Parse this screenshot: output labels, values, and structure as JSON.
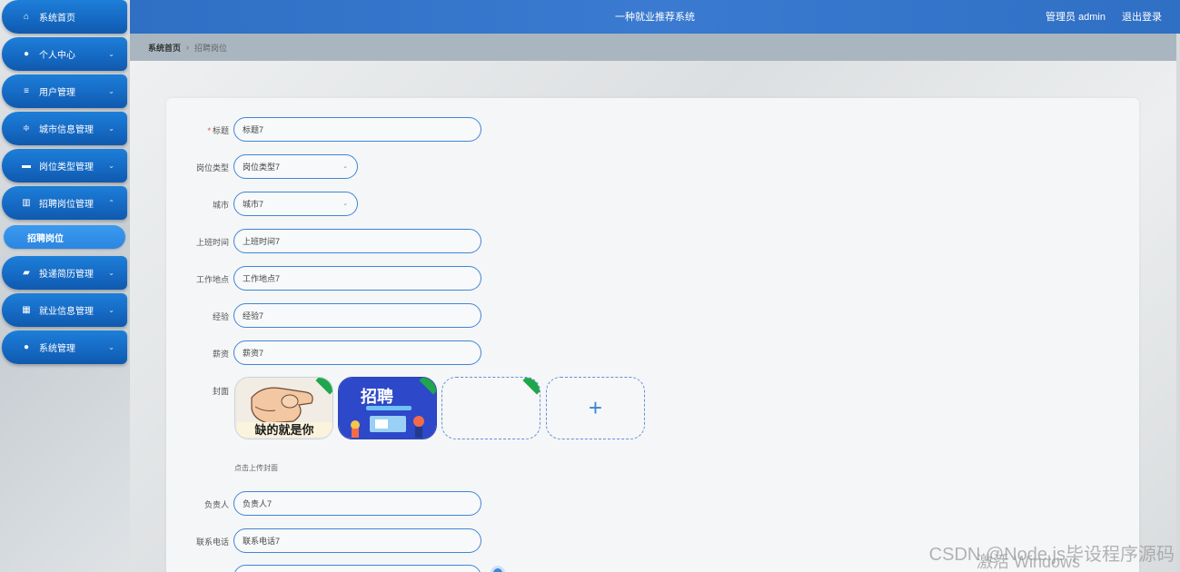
{
  "header": {
    "title": "一种就业推荐系统",
    "user": "管理员 admin",
    "logout": "退出登录"
  },
  "breadcrumb": {
    "home": "系统首页",
    "separator": "›",
    "current": "招聘岗位"
  },
  "sidebar": {
    "items": [
      {
        "label": "系统首页",
        "icon": "home-icon",
        "glyph": "⌂",
        "chevron": ""
      },
      {
        "label": "个人中心",
        "icon": "person-icon",
        "glyph": "●",
        "chevron": "⌄"
      },
      {
        "label": "用户管理",
        "icon": "list-icon",
        "glyph": "≡",
        "chevron": "⌄"
      },
      {
        "label": "城市信息管理",
        "icon": "sliders-icon",
        "glyph": "≑",
        "chevron": "⌄"
      },
      {
        "label": "岗位类型管理",
        "icon": "briefcase-icon",
        "glyph": "▬",
        "chevron": "⌄"
      },
      {
        "label": "招聘岗位管理",
        "icon": "chart-icon",
        "glyph": "▥",
        "chevron": "⌃"
      },
      {
        "label": "投递简历管理",
        "icon": "hand-icon",
        "glyph": "▰",
        "chevron": "⌄"
      },
      {
        "label": "就业信息管理",
        "icon": "grid-icon",
        "glyph": "▦",
        "chevron": "⌄"
      },
      {
        "label": "系统管理",
        "icon": "user-icon",
        "glyph": "●",
        "chevron": "⌄"
      }
    ],
    "subitem": "招聘岗位"
  },
  "form": {
    "title": {
      "label": "标题",
      "required_mark": "*",
      "value": "标题7"
    },
    "job_type": {
      "label": "岗位类型",
      "value": "岗位类型7"
    },
    "city": {
      "label": "城市",
      "value": "城市7"
    },
    "work_time": {
      "label": "上班时间",
      "value": "上班时间7"
    },
    "location": {
      "label": "工作地点",
      "value": "工作地点7"
    },
    "experience": {
      "label": "经验",
      "value": "经验7"
    },
    "salary": {
      "label": "薪资",
      "value": "薪资7"
    },
    "cover": {
      "label": "封面",
      "hint": "点击上传封面",
      "image1_text": "缺的就是你",
      "image2_text": "招聘"
    },
    "manager": {
      "label": "负责人",
      "value": "负责人7"
    },
    "phone": {
      "label": "联系电话",
      "value": "联系电话7"
    }
  },
  "overlay": {
    "watermark": "CSDN @Node.js毕设程序源码",
    "activate": "激活 Windows"
  },
  "colors": {
    "accent": "#1d7fd9",
    "header": "#3a7ad0",
    "field_border": "#3e86d6",
    "required": "#e0473f"
  }
}
